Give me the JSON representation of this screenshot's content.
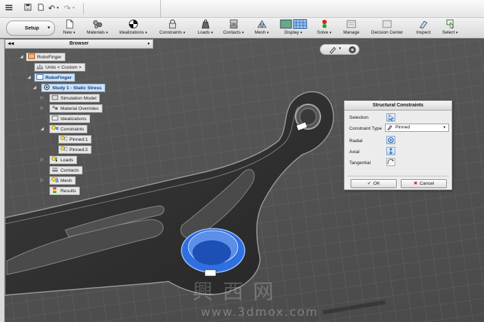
{
  "ribbon": {
    "setup_label": "Setup",
    "buttons": [
      {
        "label": "New",
        "icon": "new-icon"
      },
      {
        "label": "Materials",
        "icon": "materials-icon"
      },
      {
        "label": "Idealizations",
        "icon": "idealizations-icon"
      },
      {
        "label": "Constraints",
        "icon": "lock-icon"
      },
      {
        "label": "Loads",
        "icon": "load-weight-icon"
      },
      {
        "label": "Contacts",
        "icon": "contacts-icon"
      },
      {
        "label": "Mesh",
        "icon": "mesh-icon"
      },
      {
        "label": "Display",
        "icon": "display-icon"
      },
      {
        "label": "Solve",
        "icon": "traffic-light-icon"
      },
      {
        "label": "Manage",
        "icon": "manage-icon"
      },
      {
        "label": "Decision Center",
        "icon": "decision-center-icon"
      },
      {
        "label": "Inspect",
        "icon": "inspect-icon"
      },
      {
        "label": "Select",
        "icon": "select-cursor-icon"
      }
    ]
  },
  "browser": {
    "title": "Browser",
    "nodes": [
      {
        "label": "RoboFinger",
        "icon": "assembly-icon"
      },
      {
        "label": "Units < Custom >",
        "icon": "units-icon"
      },
      {
        "label": "RoboFinger",
        "icon": "component-icon"
      },
      {
        "label": "Study 1 - Static Stress",
        "icon": "study-target-icon"
      },
      {
        "label": "Simulation Model",
        "icon": "model-icon"
      },
      {
        "label": "Material Overrides",
        "icon": "materials-icon"
      },
      {
        "label": "Idealizations",
        "icon": "idealizations-icon"
      },
      {
        "label": "Constraints",
        "icon": "constraints-icon"
      },
      {
        "label": "Pinned:1",
        "icon": "pin-icon"
      },
      {
        "label": "Pinned:2",
        "icon": "pin-icon"
      },
      {
        "label": "Loads",
        "icon": "loads-icon"
      },
      {
        "label": "Contacts",
        "icon": "contacts-icon"
      },
      {
        "label": "Mesh",
        "icon": "mesh-icon"
      },
      {
        "label": "Results",
        "icon": "results-icon"
      }
    ]
  },
  "dialog": {
    "title": "Structural Constraints",
    "selection_label": "Selection",
    "constraint_type_label": "Constraint Type",
    "constraint_type_value": "Pinned",
    "radial_label": "Radial",
    "axial_label": "Axial",
    "tangential_label": "Tangential",
    "ok_label": "OK",
    "cancel_label": "Cancel"
  },
  "watermark": {
    "cn": "興西网",
    "url": "www.3dmox.com"
  },
  "colors": {
    "selection_blue": "#2f6fe0",
    "ribbon_bg": "#e4e4e4",
    "viewport_bg": "#5a5a5a",
    "active_node": "#cfe3f7"
  }
}
